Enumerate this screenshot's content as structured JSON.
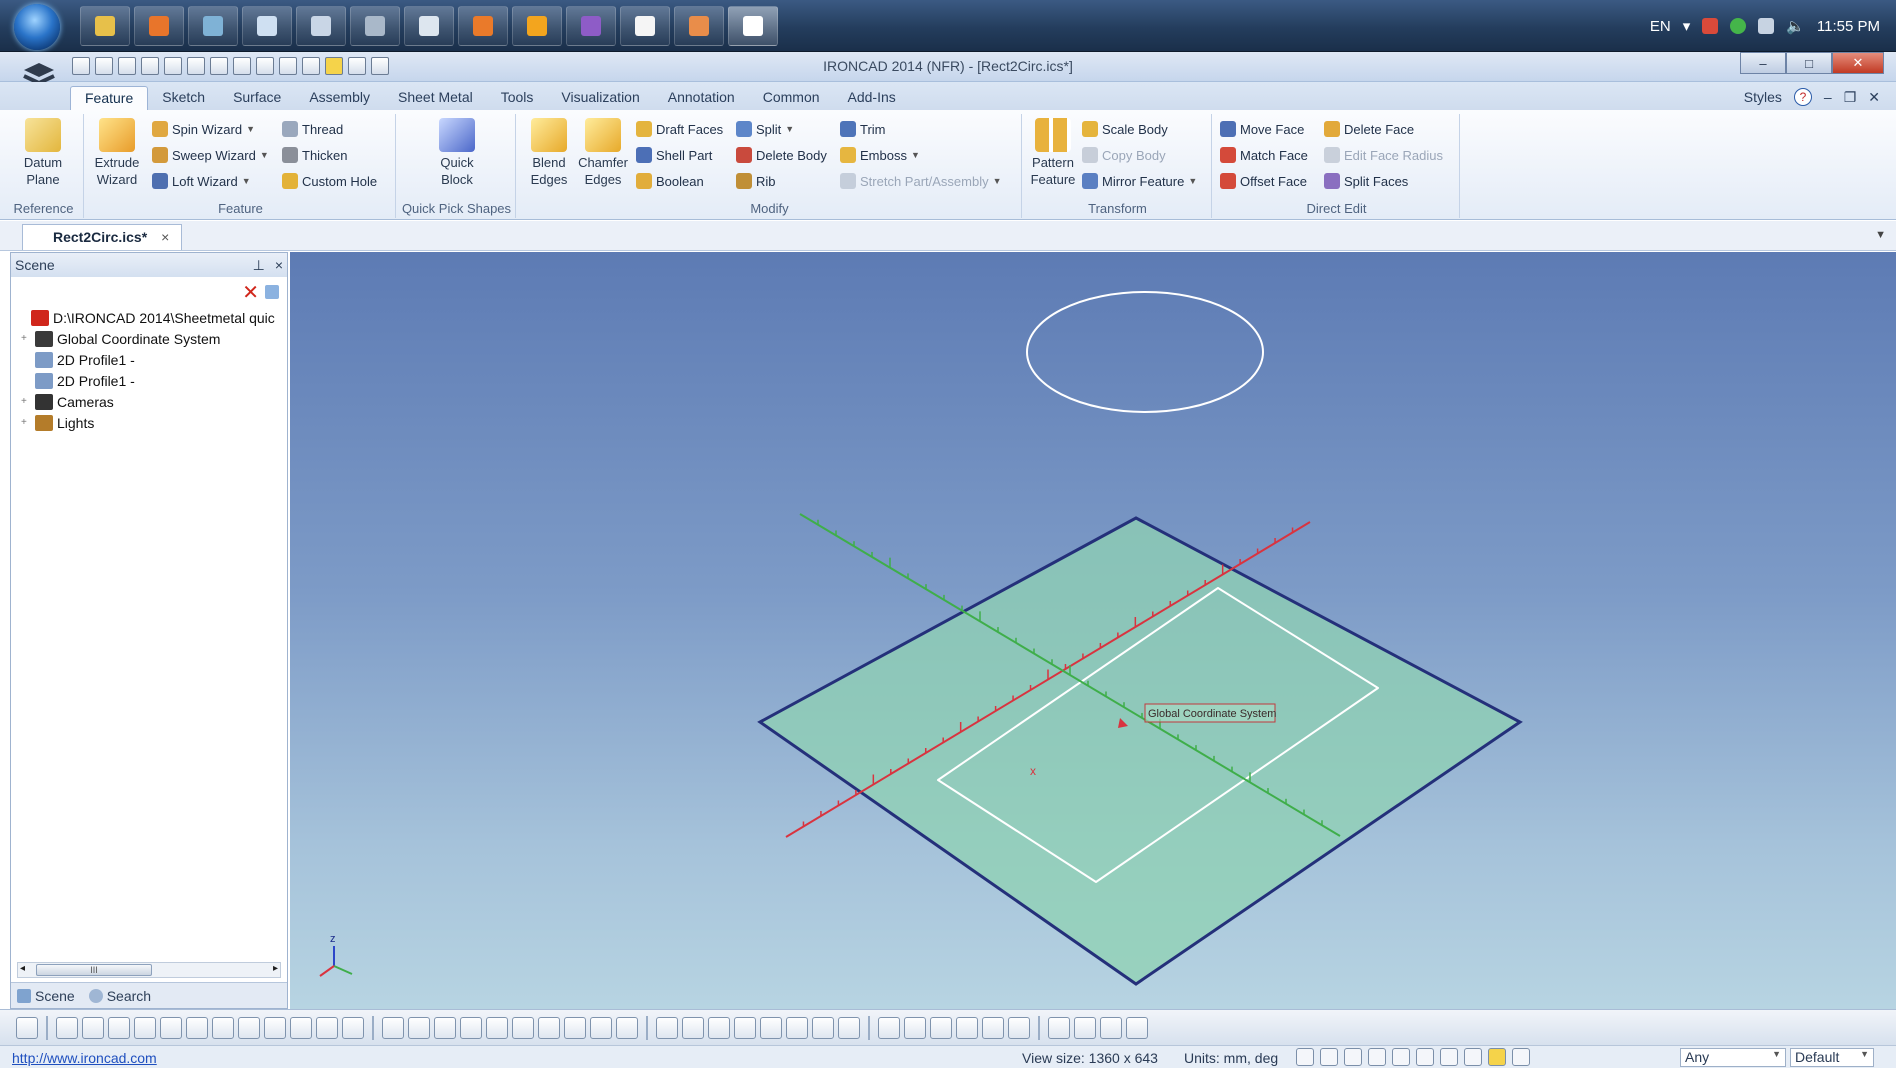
{
  "taskbar": {
    "language": "EN",
    "clock": "11:55 PM",
    "apps": [
      {
        "name": "explorer-icon",
        "color": "#e7c04a"
      },
      {
        "name": "firefox-icon",
        "color": "#e8752b"
      },
      {
        "name": "speedometer-icon",
        "color": "#7fb2d6"
      },
      {
        "name": "document-icon",
        "color": "#cfe0f2"
      },
      {
        "name": "printer-icon",
        "color": "#c9d6e6"
      },
      {
        "name": "network-icon",
        "color": "#a9b8c9"
      },
      {
        "name": "notes-icon",
        "color": "#dde6ef"
      },
      {
        "name": "pdf-icon",
        "color": "#ea7a2a"
      },
      {
        "name": "media-player-icon",
        "color": "#f3a51e"
      },
      {
        "name": "viber-icon",
        "color": "#8e5cc7"
      },
      {
        "name": "file-icon",
        "color": "#f5f5f5"
      },
      {
        "name": "archive-icon",
        "color": "#e98d4a"
      },
      {
        "name": "ironcad-icon",
        "color": "#ffffff"
      }
    ]
  },
  "window": {
    "title": "IRONCAD 2014 (NFR) - [Rect2Circ.ics*]",
    "minimize": "–",
    "maximize": "□",
    "close": "✕"
  },
  "ribbon": {
    "tabs": [
      "Feature",
      "Sketch",
      "Surface",
      "Assembly",
      "Sheet Metal",
      "Tools",
      "Visualization",
      "Annotation",
      "Common",
      "Add-Ins"
    ],
    "styles_label": "Styles",
    "groups": {
      "reference": {
        "label": "Reference",
        "datum": "Datum Plane"
      },
      "feature": {
        "label": "Feature",
        "extrude": "Extrude Wizard",
        "spin": "Spin Wizard",
        "sweep": "Sweep Wizard",
        "loft": "Loft Wizard",
        "thread": "Thread",
        "thicken": "Thicken",
        "custom_hole": "Custom Hole"
      },
      "quick_pick": {
        "label": "Quick Pick Shapes",
        "quick_block": "Quick Block"
      },
      "modify": {
        "label": "Modify",
        "blend": "Blend Edges",
        "chamfer": "Chamfer Edges",
        "draft": "Draft Faces",
        "shell": "Shell Part",
        "boolean": "Boolean",
        "split": "Split",
        "delete_body": "Delete Body",
        "rib": "Rib",
        "trim": "Trim",
        "emboss": "Emboss",
        "stretch": "Stretch Part/Assembly"
      },
      "transform": {
        "label": "Transform",
        "pattern": "Pattern Feature",
        "scale_body": "Scale Body",
        "copy_body": "Copy Body",
        "mirror": "Mirror Feature"
      },
      "direct_edit": {
        "label": "Direct Edit",
        "move_face": "Move Face",
        "match_face": "Match Face",
        "offset_face": "Offset Face",
        "delete_face": "Delete Face",
        "edit_face_radius": "Edit Face Radius",
        "split_faces": "Split Faces"
      }
    }
  },
  "document_tab": {
    "label": "Rect2Circ.ics*",
    "close": "×"
  },
  "scene": {
    "title": "Scene",
    "pin": "⊥",
    "close": "×",
    "tree": [
      {
        "label": "D:\\IRONCAD 2014\\Sheetmetal quic",
        "icon": "scene-root-icon",
        "expander": ""
      },
      {
        "label": "Global Coordinate System",
        "icon": "coordinate-system-icon",
        "expander": "+"
      },
      {
        "label": "2D Profile1 -",
        "icon": "profile-icon",
        "expander": ""
      },
      {
        "label": "2D Profile1 -",
        "icon": "profile-icon",
        "expander": ""
      },
      {
        "label": "Cameras",
        "icon": "camera-icon",
        "expander": "+"
      },
      {
        "label": "Lights",
        "icon": "light-icon",
        "expander": "+"
      }
    ],
    "footer_tabs": [
      "Scene",
      "Search"
    ],
    "scroll_mark": "III"
  },
  "viewport": {
    "gcs_label": "Global Coordinate System",
    "axis_x_label": "x",
    "axis_z_label": "z",
    "colors": {
      "plane": "#8fd1b3",
      "plane_edge": "#24307a",
      "x_axis": "#d9333f",
      "y_axis": "#3fae4a",
      "sketch": "#ffffff"
    }
  },
  "status": {
    "url": "http://www.ironcad.com",
    "view_size": "View size: 1360 x 643",
    "units": "Units: mm, deg",
    "selection_filter": "Any",
    "style": "Default"
  }
}
